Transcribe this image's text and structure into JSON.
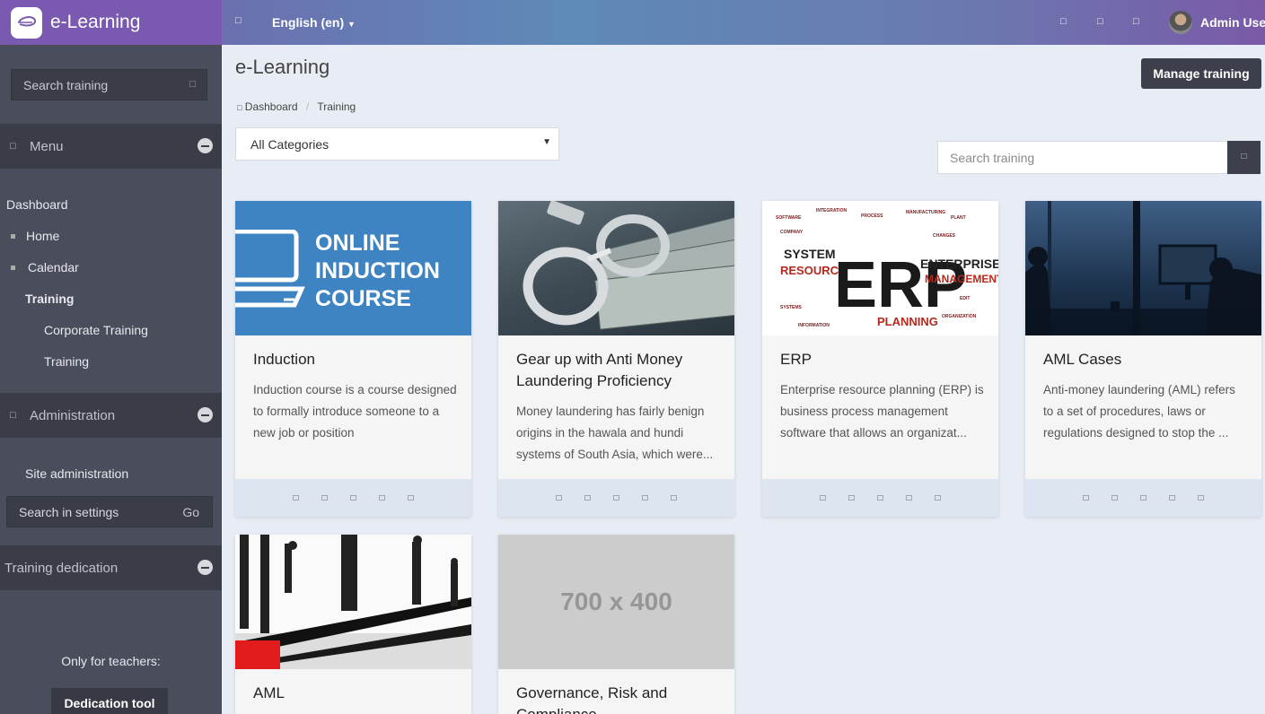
{
  "brand": {
    "title": "e-Learning"
  },
  "topbar": {
    "language": "English (en)",
    "user_name": "Admin User",
    "toggle_icon": "bars-icon"
  },
  "sidebar": {
    "search_placeholder": "Search training",
    "menu_heading": "Menu",
    "nav": {
      "dashboard": "Dashboard",
      "home": "Home",
      "calendar": "Calendar",
      "training": "Training",
      "corporate_training": "Corporate Training",
      "training_sub": "Training"
    },
    "admin_heading": "Administration",
    "site_admin": "Site administration",
    "settings_placeholder": "Search in settings",
    "settings_go": "Go",
    "dedication_heading": "Training dedication",
    "teachers_note": "Only for teachers:",
    "dedication_button": "Dedication tool"
  },
  "main": {
    "title": "e-Learning",
    "manage_button": "Manage training",
    "breadcrumb": [
      "Dashboard",
      "Training"
    ],
    "category_select": "All Categories",
    "search_placeholder": "Search training"
  },
  "cards": [
    {
      "title": "Induction",
      "desc": "Induction course is a course designed to formally introduce someone to a new job or position",
      "image_text": [
        "ONLINE",
        "INDUCTION",
        "COURSE"
      ]
    },
    {
      "title": "Gear up with Anti Money Laundering Proficiency",
      "desc": "Money laundering has fairly benign origins in the hawala and hundi systems of South Asia, which were..."
    },
    {
      "title": "ERP",
      "desc": "Enterprise resource planning (ERP) is business process management software that allows an organizat...",
      "image_text": [
        "SYSTEM",
        "RESOURCE",
        "ERP",
        "ENTERPRISE",
        "MANAGEMENT",
        "PLANNING"
      ]
    },
    {
      "title": "AML Cases",
      "desc": "Anti-money laundering (AML) refers to a set of procedures, laws or regulations designed to stop the ..."
    },
    {
      "title": "AML",
      "desc": ""
    },
    {
      "title": "Governance, Risk and Compliance",
      "desc": "",
      "image_text": "700 x 400"
    }
  ]
}
